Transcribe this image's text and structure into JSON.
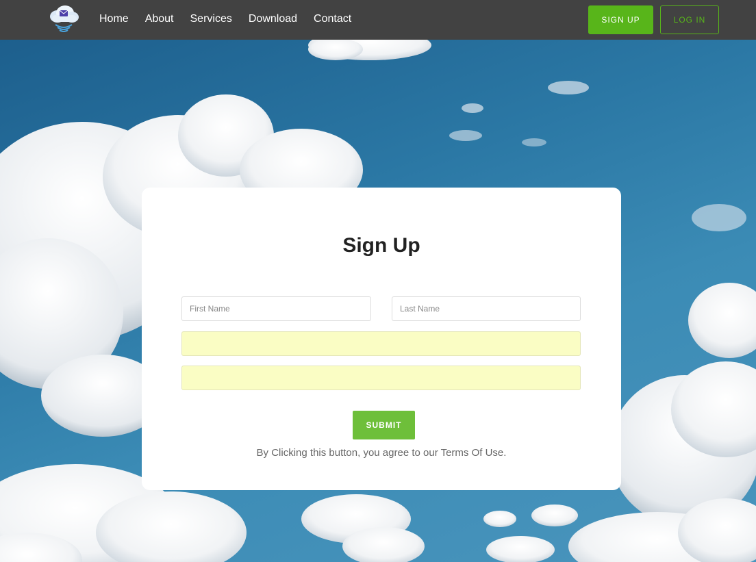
{
  "nav": {
    "logo_icon": "cloud-mail-icon",
    "links": [
      "Home",
      "About",
      "Services",
      "Download",
      "Contact"
    ],
    "signup_label": "SIGN UP",
    "login_label": "LOG IN",
    "accent_color": "#58b51a",
    "bar_color": "#424242"
  },
  "form": {
    "title": "Sign Up",
    "first_name_placeholder": "First Name",
    "last_name_placeholder": "Last Name",
    "email_value": "",
    "password_value": "",
    "submit_label": "SUBMIT",
    "terms_text": "By Clicking this button, you agree to our Terms Of Use.",
    "autofill_color": "#fafdc4"
  }
}
